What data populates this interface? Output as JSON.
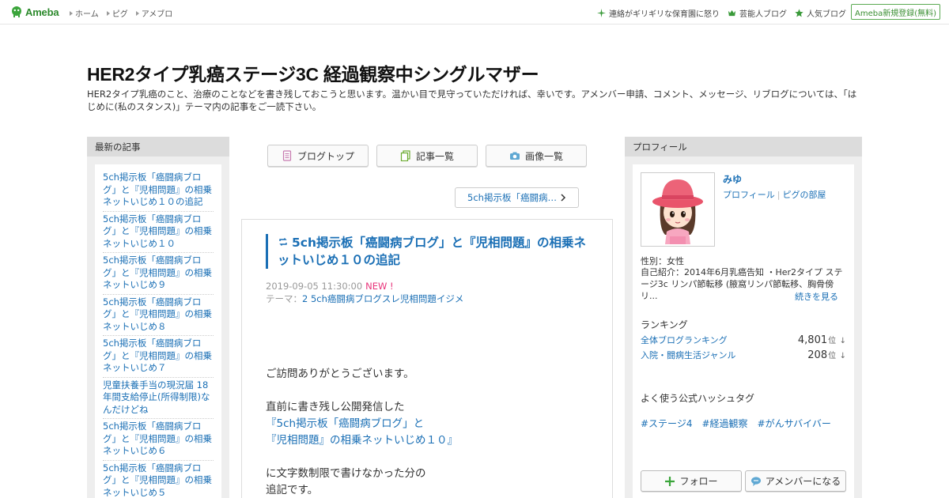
{
  "topbar": {
    "logo": "Ameba",
    "nav": [
      "ホーム",
      "ピグ",
      "アメブロ"
    ],
    "right_links": [
      {
        "label": "連絡がギリギリな保育園に怒り",
        "icon": "sparkle-icon"
      },
      {
        "label": "芸能人ブログ",
        "icon": "crown-icon"
      },
      {
        "label": "人気ブログ",
        "icon": "star-icon"
      }
    ],
    "register": "Ameba新規登録(無料)"
  },
  "header": {
    "title": "HER2タイプ乳癌ステージ3C 経過観察中シングルマザー",
    "description": "HER2タイプ乳癌のこと、治療のことなどを書き残しておこうと思います。温かい目で見守っていただければ、幸いです。アメンバー申請、コメント、メッセージ、リブログについては、「はじめに(私のスタンス)」テーマ内の記事をご一読下さい。"
  },
  "recent": {
    "heading": "最新の記事",
    "items": [
      "5ch掲示板「癌闘病ブログ」と『児相問題』の相乗ネットいじめ１０の追記",
      "5ch掲示板「癌闘病ブログ」と『児相問題』の相乗ネットいじめ１０",
      "5ch掲示板「癌闘病ブログ」と『児相問題』の相乗ネットいじめ９",
      "5ch掲示板「癌闘病ブログ」と『児相問題』の相乗ネットいじめ８",
      "5ch掲示板「癌闘病ブログ」と『児相問題』の相乗ネットいじめ７",
      "児童扶養手当の現況届 18年間支給停止(所得制限)なんだけどね",
      "5ch掲示板「癌闘病ブログ」と『児相問題』の相乗ネットいじめ６",
      "5ch掲示板「癌闘病ブログ」と『児相問題』の相乗ネットいじめ５"
    ]
  },
  "midnav": {
    "blogtop": "ブログトップ",
    "entries": "記事一覧",
    "images": "画像一覧",
    "next": "5ch掲示板「癌闘病…"
  },
  "article": {
    "title": "5ch掲示板「癌闘病ブログ」と『児相問題』の相乗ネットいじめ１０の追記",
    "date": "2019-09-05 11:30:00",
    "new_label": "NEW !",
    "theme_prefix": "テーマ：",
    "theme": "2 5ch癌闘病ブログスレ児相問題イジメ",
    "p1": "ご訪問ありがとうございます。",
    "p2": "直前に書き残し公開発信した",
    "link1": "『5ch掲示板「癌闘病ブログ」と",
    "link2": "『児相問題』の相乗ネットいじめ１０』",
    "p3": "に文字数制限で書けなかった分の",
    "p4": "追記です。"
  },
  "profile": {
    "heading": "プロフィール",
    "name": "みゆ",
    "link_profile": "プロフィール",
    "link_room": "ピグの部屋",
    "gender": "性別：女性",
    "intro": "自己紹介：2014年6月乳癌告知 ・Her2タイプ ステージ3c リンパ節転移 (腋窩リンパ節転移、胸骨傍リ...",
    "more": "続きを見る",
    "ranking_heading": "ランキング",
    "rankings": [
      {
        "label": "全体ブログランキング",
        "value": "4,801",
        "unit": "位",
        "arrow": "↓"
      },
      {
        "label": "入院・闘病生活ジャンル",
        "value": "208",
        "unit": "位",
        "arrow": "↓"
      }
    ],
    "hashtag_heading": "よく使う公式ハッシュタグ",
    "hashtags": [
      "#ステージ4",
      "#経過観察",
      "#がんサバイバー"
    ],
    "follow": "フォロー",
    "amember": "アメンバーになる"
  },
  "colors": {
    "link": "#1a6fb5",
    "new": "#e8337a",
    "brand": "#2d8a2d"
  }
}
